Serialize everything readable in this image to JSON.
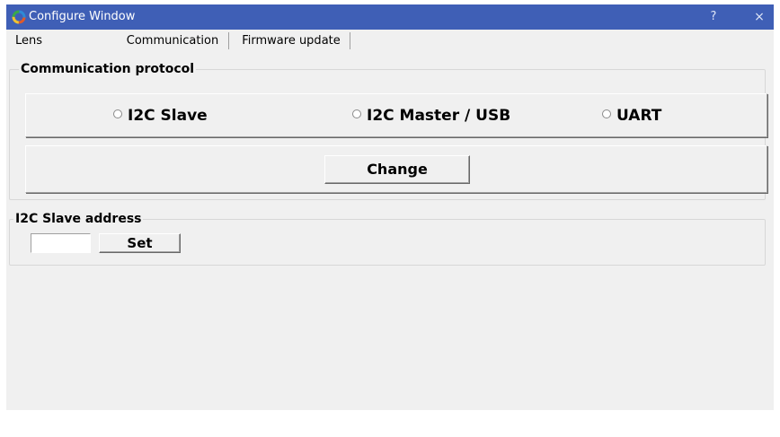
{
  "window": {
    "title": "Configure Window",
    "help_label": "?",
    "close_label": "×"
  },
  "tabs": [
    {
      "label": "Lens"
    },
    {
      "label": "Communication",
      "selected": true
    },
    {
      "label": "Firmware update"
    }
  ],
  "protocol_group": {
    "legend": "Communication protocol",
    "options": [
      {
        "label": "I2C Slave",
        "checked": false
      },
      {
        "label": "I2C Master / USB",
        "checked": false
      },
      {
        "label": "UART",
        "checked": false
      }
    ],
    "change_label": "Change"
  },
  "address_group": {
    "legend": "I2C Slave address",
    "input_value": "",
    "set_label": "Set"
  },
  "colors": {
    "titlebar": "#3f5fb6",
    "window_bg": "#f0f0f0"
  }
}
